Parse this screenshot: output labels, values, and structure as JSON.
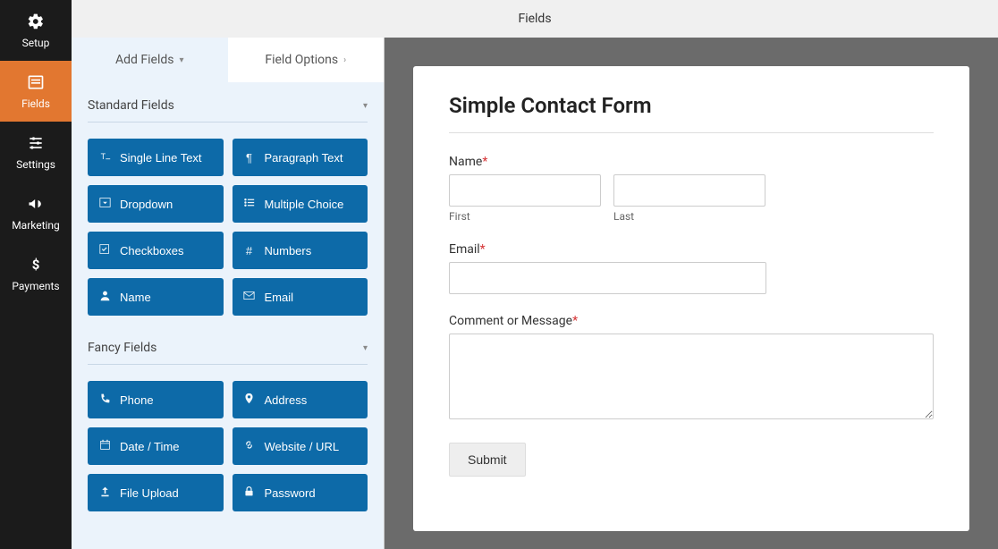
{
  "nav": {
    "setup": "Setup",
    "fields": "Fields",
    "settings": "Settings",
    "marketing": "Marketing",
    "payments": "Payments"
  },
  "topbar": {
    "title": "Fields"
  },
  "tabs": {
    "add": "Add Fields",
    "options": "Field Options"
  },
  "sections": {
    "standard": {
      "title": "Standard Fields",
      "items": {
        "single_line": "Single Line Text",
        "paragraph": "Paragraph Text",
        "dropdown": "Dropdown",
        "multiple": "Multiple Choice",
        "checkboxes": "Checkboxes",
        "numbers": "Numbers",
        "name": "Name",
        "email": "Email"
      }
    },
    "fancy": {
      "title": "Fancy Fields",
      "items": {
        "phone": "Phone",
        "address": "Address",
        "datetime": "Date / Time",
        "website": "Website / URL",
        "upload": "File Upload",
        "password": "Password"
      }
    }
  },
  "form": {
    "title": "Simple Contact Form",
    "name_label": "Name",
    "first_sub": "First",
    "last_sub": "Last",
    "email_label": "Email",
    "msg_label": "Comment or Message",
    "submit": "Submit",
    "req": "*"
  }
}
